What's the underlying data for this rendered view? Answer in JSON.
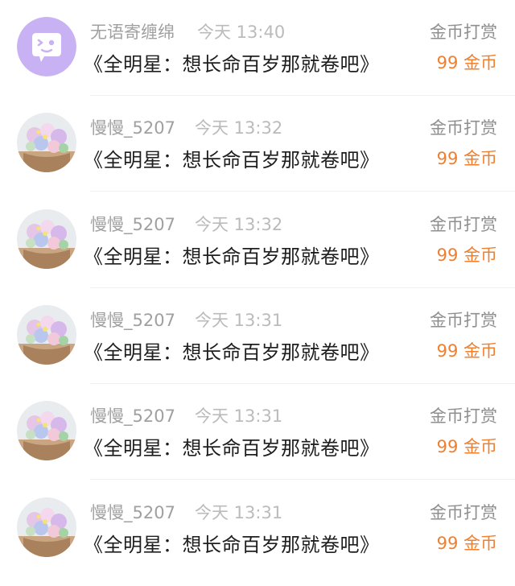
{
  "colors": {
    "coin_orange": "#f07f2e",
    "avatar_purple": "#c9b2f3"
  },
  "items": [
    {
      "username": "无语寄缠绵",
      "time": "今天 13:40",
      "title": "《全明星：想长命百岁那就卷吧》",
      "gift_label": "金币打赏",
      "coin": "99 金币",
      "avatar": "chat-bubble-icon"
    },
    {
      "username": "慢慢_5207",
      "time": "今天 13:32",
      "title": "《全明星：想长命百岁那就卷吧》",
      "gift_label": "金币打赏",
      "coin": "99 金币",
      "avatar": "flower-basket-photo"
    },
    {
      "username": "慢慢_5207",
      "time": "今天 13:32",
      "title": "《全明星：想长命百岁那就卷吧》",
      "gift_label": "金币打赏",
      "coin": "99 金币",
      "avatar": "flower-basket-photo"
    },
    {
      "username": "慢慢_5207",
      "time": "今天 13:31",
      "title": "《全明星：想长命百岁那就卷吧》",
      "gift_label": "金币打赏",
      "coin": "99 金币",
      "avatar": "flower-basket-photo"
    },
    {
      "username": "慢慢_5207",
      "time": "今天 13:31",
      "title": "《全明星：想长命百岁那就卷吧》",
      "gift_label": "金币打赏",
      "coin": "99 金币",
      "avatar": "flower-basket-photo"
    },
    {
      "username": "慢慢_5207",
      "time": "今天 13:31",
      "title": "《全明星：想长命百岁那就卷吧》",
      "gift_label": "金币打赏",
      "coin": "99 金币",
      "avatar": "flower-basket-photo"
    }
  ]
}
